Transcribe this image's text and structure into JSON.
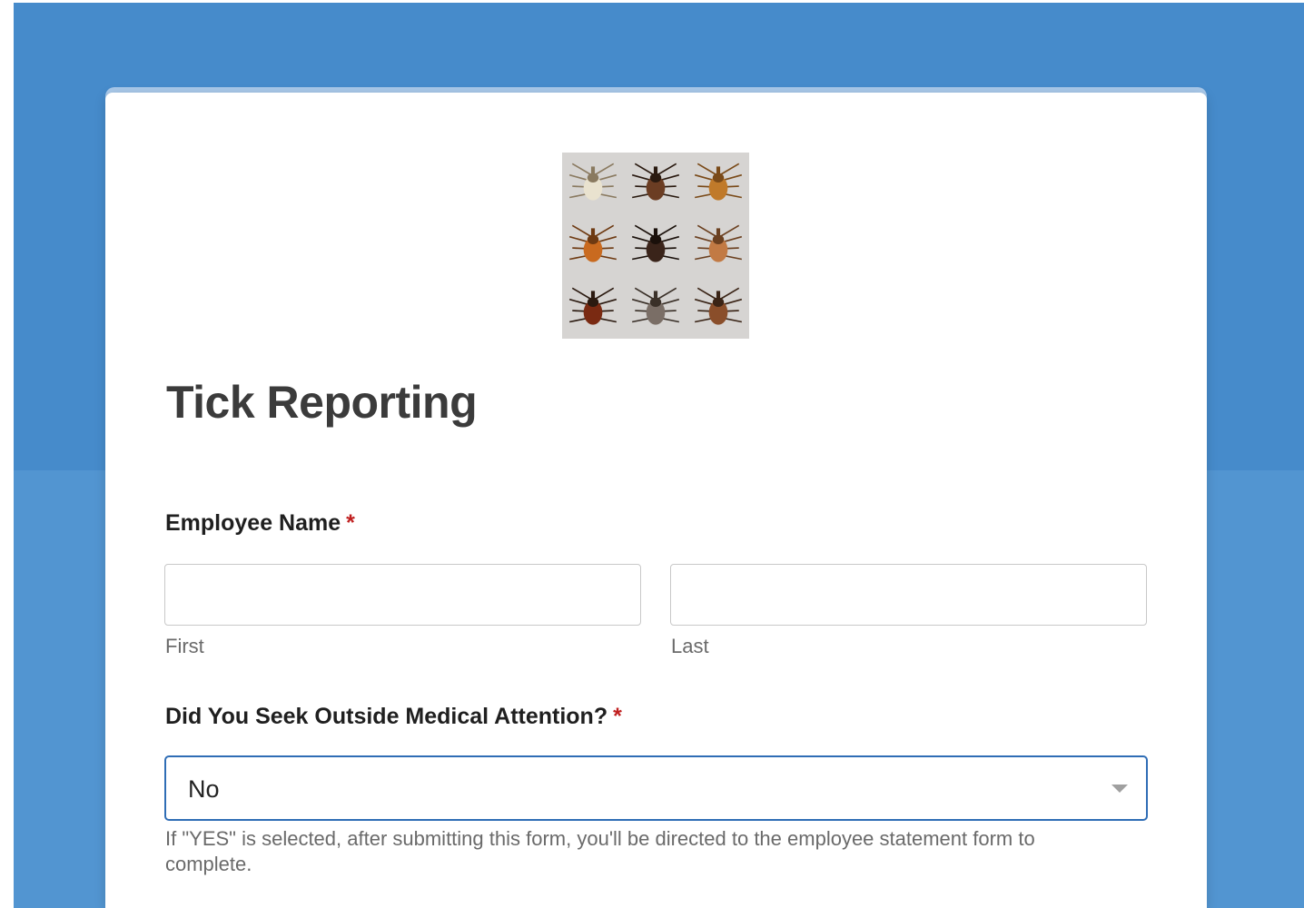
{
  "form": {
    "title": "Tick Reporting",
    "logo_icon": "tick-species-grid",
    "fields": {
      "employee_name": {
        "label": "Employee Name",
        "required_mark": "*",
        "first": {
          "value": "",
          "sublabel": "First"
        },
        "last": {
          "value": "",
          "sublabel": "Last"
        }
      },
      "medical_attention": {
        "label": "Did You Seek Outside Medical Attention?",
        "required_mark": "*",
        "selected_value": "No",
        "help_text": "If \"YES\" is selected, after submitting this form, you'll be directed to the employee statement form to complete."
      }
    }
  },
  "colors": {
    "background_top": "#468bcb",
    "background_bottom": "#5295d1",
    "card": "#ffffff",
    "select_border": "#2f6db5",
    "required": "#c02020"
  }
}
